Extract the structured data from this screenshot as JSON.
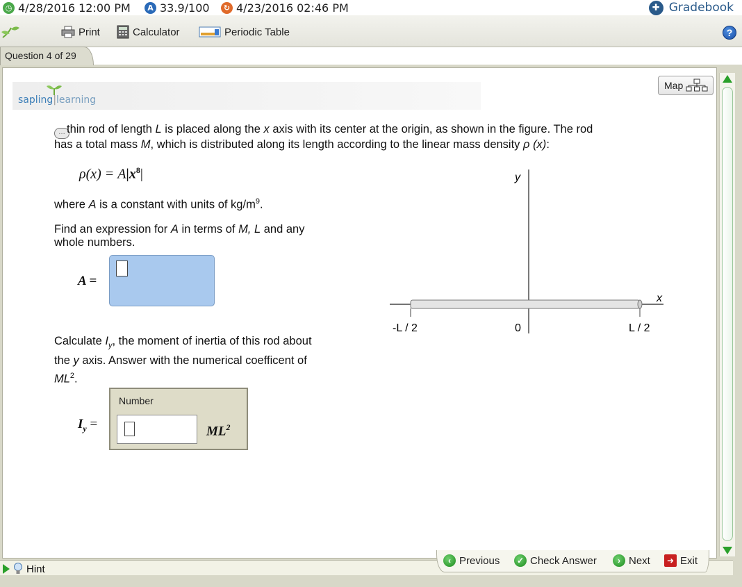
{
  "status": {
    "due_date": "4/28/2016 12:00 PM",
    "score": "33.9/100",
    "last_date": "4/23/2016 02:46 PM",
    "gradebook_label": "Gradebook"
  },
  "toolbar": {
    "print_label": "Print",
    "calculator_label": "Calculator",
    "periodic_table_label": "Periodic Table",
    "help_glyph": "?"
  },
  "question": {
    "tab_label": "Question 4 of 29",
    "map_label": "Map",
    "logo_a": "sapling",
    "logo_b": "learning",
    "intro_part1": "thin rod of length ",
    "L": "L",
    "intro_part2": " is placed along the ",
    "x": "x",
    "intro_part3": " axis with its center at the origin, as shown in the figure.  The rod",
    "intro_line2a": "has a total mass ",
    "M": "M",
    "intro_line2b": ", which is distributed along its length according to the linear mass density ",
    "rho_x": "ρ (x)",
    "intro_line2c": ":",
    "formula_lhs": "ρ(x) = A",
    "formula_rhs": "|x",
    "formula_exp": "8",
    "formula_end": "|",
    "where_a": "where ",
    "A": "A",
    "where_b": " is a constant with units of kg/m",
    "where_exp": "9",
    "where_c": ".",
    "find_a": "Find an expression for ",
    "find_b": " in terms of ",
    "find_c": "M, L",
    "find_d": " and any whole numbers.",
    "a_label": "A =",
    "calc_a": "Calculate ",
    "Iy": "I",
    "Iy_sub": "y",
    "calc_b": ", the moment of inertia of this rod about the ",
    "y": "y",
    "calc_c": " axis.  Answer with the numerical coefficent of ",
    "ML": "ML",
    "ML_exp": "2",
    "calc_d": ".",
    "number_label": "Number",
    "iy_label": "I",
    "iy_sub": "y",
    "iy_eq": "=",
    "unit_ML": "ML",
    "unit_exp": "2"
  },
  "figure": {
    "y_axis_label": "y",
    "x_axis_label": "x",
    "left_label": "-L / 2",
    "zero_label": "0",
    "right_label": "L / 2"
  },
  "nav": {
    "hint_label": "Hint",
    "previous_label": "Previous",
    "check_label": "Check Answer",
    "next_label": "Next",
    "exit_label": "Exit"
  },
  "colors": {
    "input_blue": "#a9c9ee",
    "accent_green": "#2aa02a",
    "link_blue": "#2a5a8a"
  }
}
